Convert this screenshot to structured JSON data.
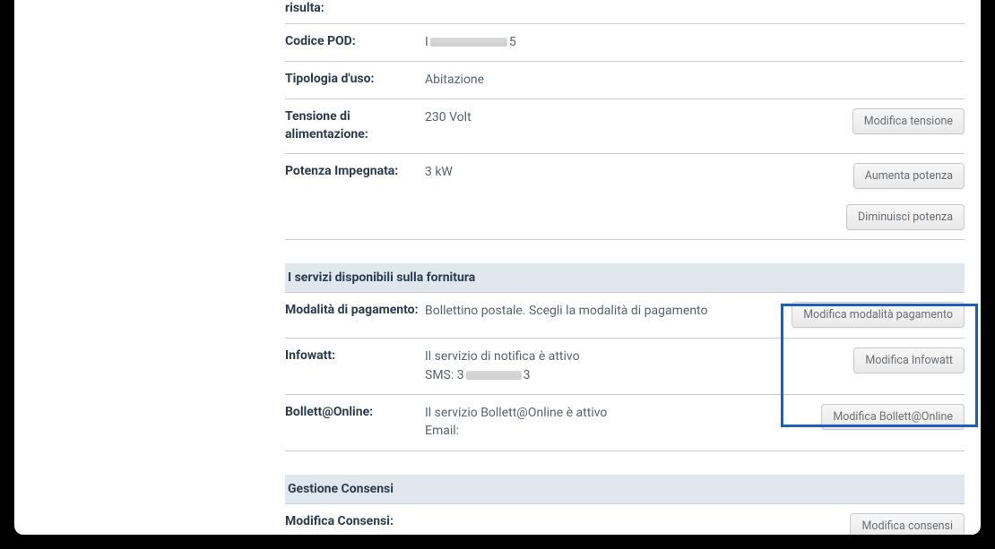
{
  "supply": {
    "risulta_label": "risulta:",
    "pod_label": "Codice POD:",
    "pod_value_prefix": "I",
    "pod_value_suffix": "5",
    "tipologia_label": "Tipologia d'uso:",
    "tipologia_value": "Abitazione",
    "tensione_label": "Tensione di alimentazione:",
    "tensione_value": "230 Volt",
    "btn_modifica_tensione": "Modifica tensione",
    "potenza_label": "Potenza Impegnata:",
    "potenza_value": "3 kW",
    "btn_aumenta_potenza": "Aumenta potenza",
    "btn_diminuisci_potenza": "Diminuisci potenza"
  },
  "services": {
    "header": "I servizi disponibili sulla fornitura",
    "pagamento_label": "Modalità di pagamento:",
    "pagamento_value": "Bollettino postale. Scegli la modalità di pagamento",
    "btn_modifica_pagamento": "Modifica modalità pagamento",
    "infowatt_label": "Infowatt:",
    "infowatt_line1": "Il servizio di notifica è attivo",
    "infowatt_sms_prefix": "SMS: 3",
    "infowatt_sms_suffix": "3",
    "btn_modifica_infowatt": "Modifica Infowatt",
    "bollett_label": "Bollett@Online:",
    "bollett_line1": "Il servizio Bollett@Online è attivo",
    "bollett_email": "Email:",
    "btn_modifica_bollett": "Modifica Bollett@Online"
  },
  "consensi": {
    "header": "Gestione Consensi",
    "modifica_label": "Modifica Consensi:",
    "btn_modifica_consensi": "Modifica consensi"
  }
}
